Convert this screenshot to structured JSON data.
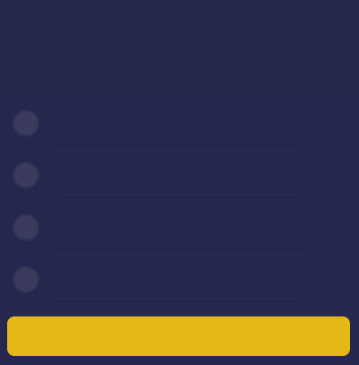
{
  "header": {
    "text": ""
  },
  "list": {
    "items": [
      {
        "icon": "circle-icon",
        "label": "",
        "value": ""
      },
      {
        "icon": "circle-icon",
        "label": "",
        "value": ""
      },
      {
        "icon": "circle-icon",
        "label": "",
        "value": ""
      },
      {
        "icon": "circle-icon",
        "label": "",
        "value": ""
      }
    ]
  },
  "actions": {
    "primary_label": ""
  },
  "colors": {
    "background": "#26284f",
    "accent": "#e4b917"
  }
}
